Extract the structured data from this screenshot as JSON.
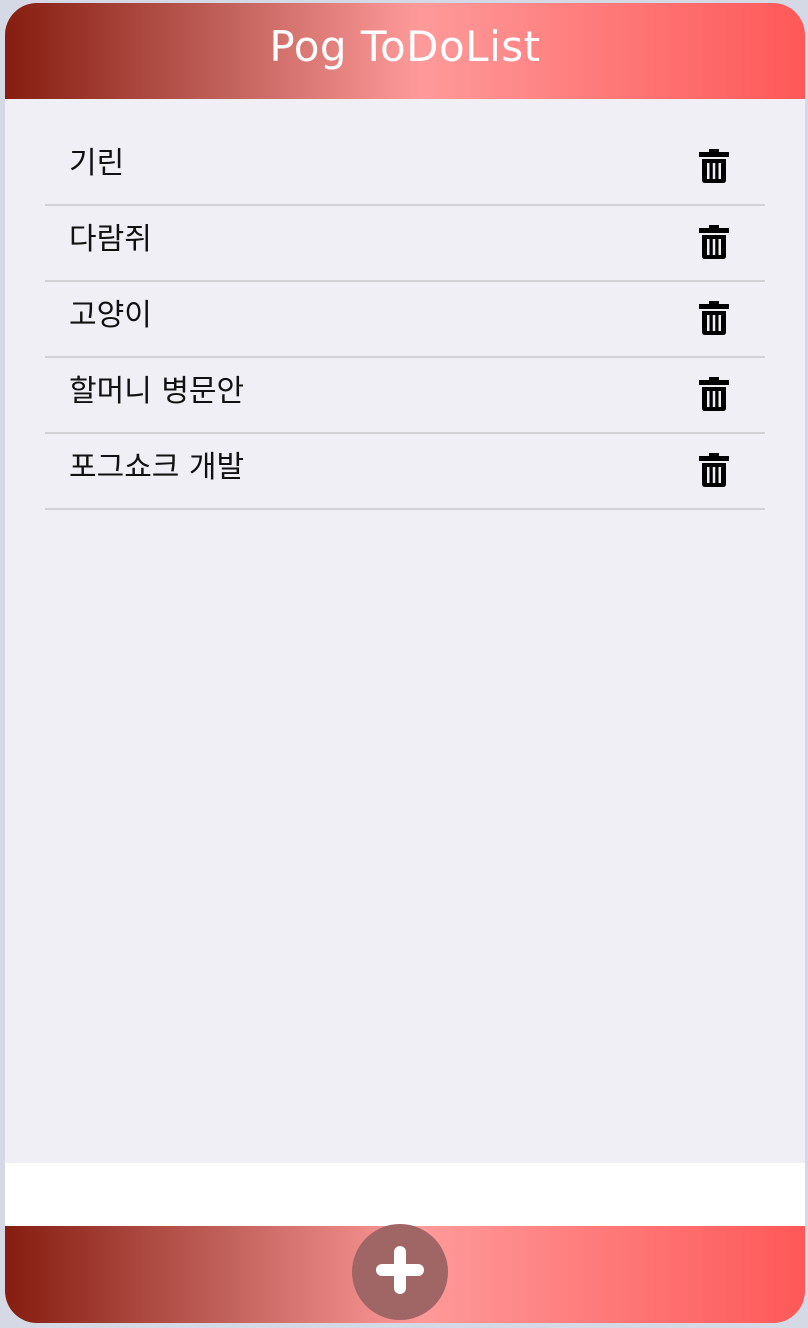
{
  "header": {
    "title": "Pog ToDoList"
  },
  "todos": [
    {
      "text": "기린"
    },
    {
      "text": "다람쥐"
    },
    {
      "text": "고양이"
    },
    {
      "text": "할머니 병문안"
    },
    {
      "text": "포그쇼크 개발"
    }
  ],
  "icons": {
    "delete": "trash-icon",
    "add": "plus-icon"
  },
  "colors": {
    "gradient_start": "#861d10",
    "gradient_mid": "#ff9a9a",
    "gradient_end": "#ff5858",
    "list_bg": "#f0eff5",
    "add_button": "#a06666"
  }
}
